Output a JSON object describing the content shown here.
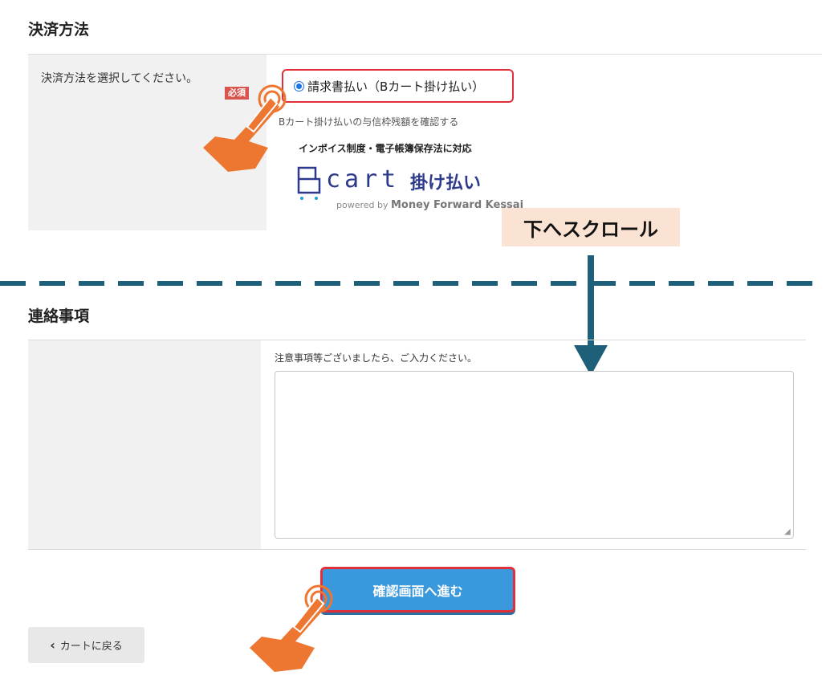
{
  "payment": {
    "section_title": "決済方法",
    "label": "決済方法を選択してください。",
    "required_badge": "必須",
    "option_label": "請求書払い（Bカート掛け払い）",
    "credit_check_link": "Bカート掛け払いの与信枠残額を確認する",
    "invoice_note": "インボイス制度・電子帳簿保存法に対応",
    "logo": {
      "wordmark": "cart",
      "jp": "掛け払い",
      "powered_prefix": "powered by",
      "powered_brand": "Money Forward Kessai"
    }
  },
  "overlay": {
    "scroll_label": "下へスクロール",
    "accent_color": "#ed7631",
    "arrow_color": "#1e5f7a"
  },
  "contact": {
    "section_title": "連絡事項",
    "hint": "注意事項等ございましたら、ご入力ください。",
    "textarea_value": ""
  },
  "actions": {
    "confirm_label": "確認画面へ進む",
    "back_label": "カートに戻る",
    "confirm_color": "#3a99dd",
    "highlight_color": "#e0313b"
  },
  "icons": {
    "pointer": "hand-pointer-icon",
    "back": "chevron-left-icon",
    "down": "arrow-down-icon"
  }
}
